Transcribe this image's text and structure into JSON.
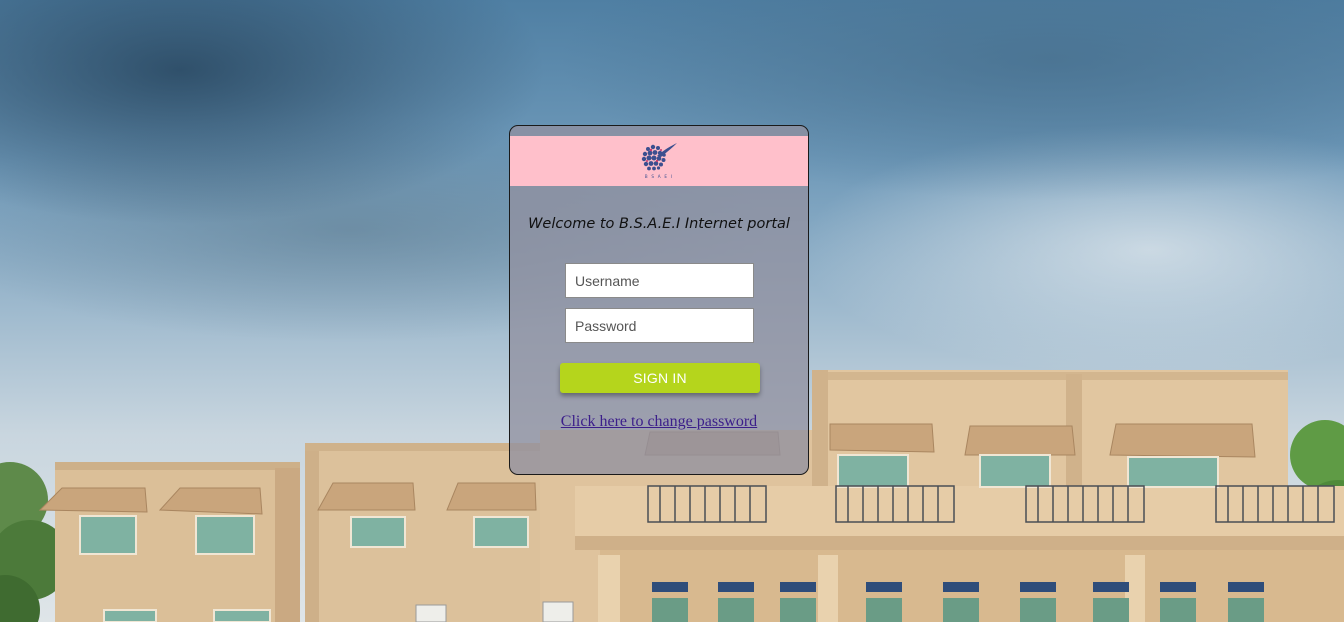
{
  "card": {
    "logo_icon": "bsaei-globe-logo-icon",
    "logo_caption": "B S A E I",
    "welcome_text": "Welcome to B.S.A.E.I Internet portal"
  },
  "form": {
    "username_placeholder": "Username",
    "password_placeholder": "Password",
    "username_value": "",
    "password_value": "",
    "signin_label": "SIGN IN",
    "change_password_link": "Click here to change password"
  },
  "colors": {
    "header_pink": "#ffc0cb",
    "signin_green": "#b5d51c",
    "link_purple": "#3b1e8a"
  }
}
